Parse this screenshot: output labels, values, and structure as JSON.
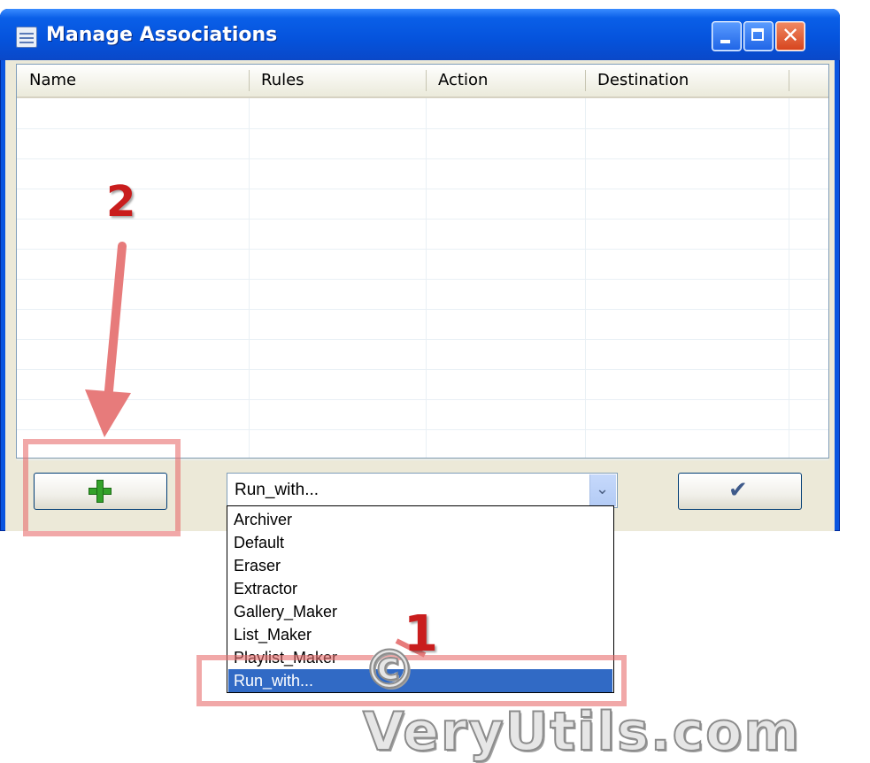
{
  "window": {
    "title": "Manage Associations",
    "controls": [
      "minimize-icon",
      "maximize-icon",
      "close-icon"
    ],
    "close_glyph": "✕"
  },
  "list": {
    "columns": [
      "Name",
      "Rules",
      "Action",
      "Destination"
    ]
  },
  "buttons": {
    "add_icon": "plus-icon",
    "confirm_icon": "checkmark-icon",
    "confirm_glyph": "✔"
  },
  "combo": {
    "value": "Run_with...",
    "arrow_glyph": "⌄",
    "options": [
      "Archiver",
      "Default",
      "Eraser",
      "Extractor",
      "Gallery_Maker",
      "List_Maker",
      "Playlist_Maker",
      "Run_with..."
    ],
    "selected": "Run_with..."
  },
  "annotations": {
    "step1": "1",
    "step2": "2",
    "watermark": "© VeryUtils.com"
  },
  "colors": {
    "titlebar": "#0553dc",
    "selection": "#316ac5",
    "annotation": "#c91d1d",
    "add_icon": "#34a22a"
  }
}
